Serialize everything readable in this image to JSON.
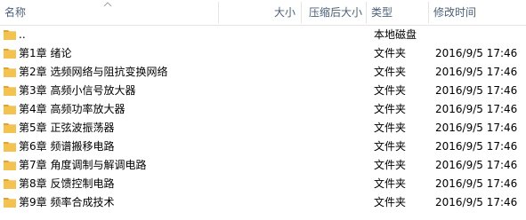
{
  "header": {
    "name": "名称",
    "size": "大小",
    "compressed_size": "压缩后大小",
    "type": "类型",
    "modified": "修改时间",
    "sort_indicator_icon": "chevron-up-icon"
  },
  "rows": [
    {
      "name": "..",
      "type": "本地磁盘",
      "modified": ""
    },
    {
      "name": "第1章 绪论",
      "type": "文件夹",
      "modified": "2016/9/5 17:46"
    },
    {
      "name": "第2章 选频网络与阻抗变换网络",
      "type": "文件夹",
      "modified": "2016/9/5 17:46"
    },
    {
      "name": "第3章 高频小信号放大器",
      "type": "文件夹",
      "modified": "2016/9/5 17:46"
    },
    {
      "name": "第4章 高频功率放大器",
      "type": "文件夹",
      "modified": "2016/9/5 17:46"
    },
    {
      "name": "第5章 正弦波振荡器",
      "type": "文件夹",
      "modified": "2016/9/5 17:46"
    },
    {
      "name": "第6章 频谱搬移电路",
      "type": "文件夹",
      "modified": "2016/9/5 17:46"
    },
    {
      "name": "第7章 角度调制与解调电路",
      "type": "文件夹",
      "modified": "2016/9/5 17:46"
    },
    {
      "name": "第8章 反馈控制电路",
      "type": "文件夹",
      "modified": "2016/9/5 17:46"
    },
    {
      "name": "第9章 频率合成技术",
      "type": "文件夹",
      "modified": "2016/9/5 17:46"
    }
  ],
  "colors": {
    "folder": "#f3c24f",
    "folder_dark": "#e0a52e",
    "header_text": "#4c607a"
  }
}
